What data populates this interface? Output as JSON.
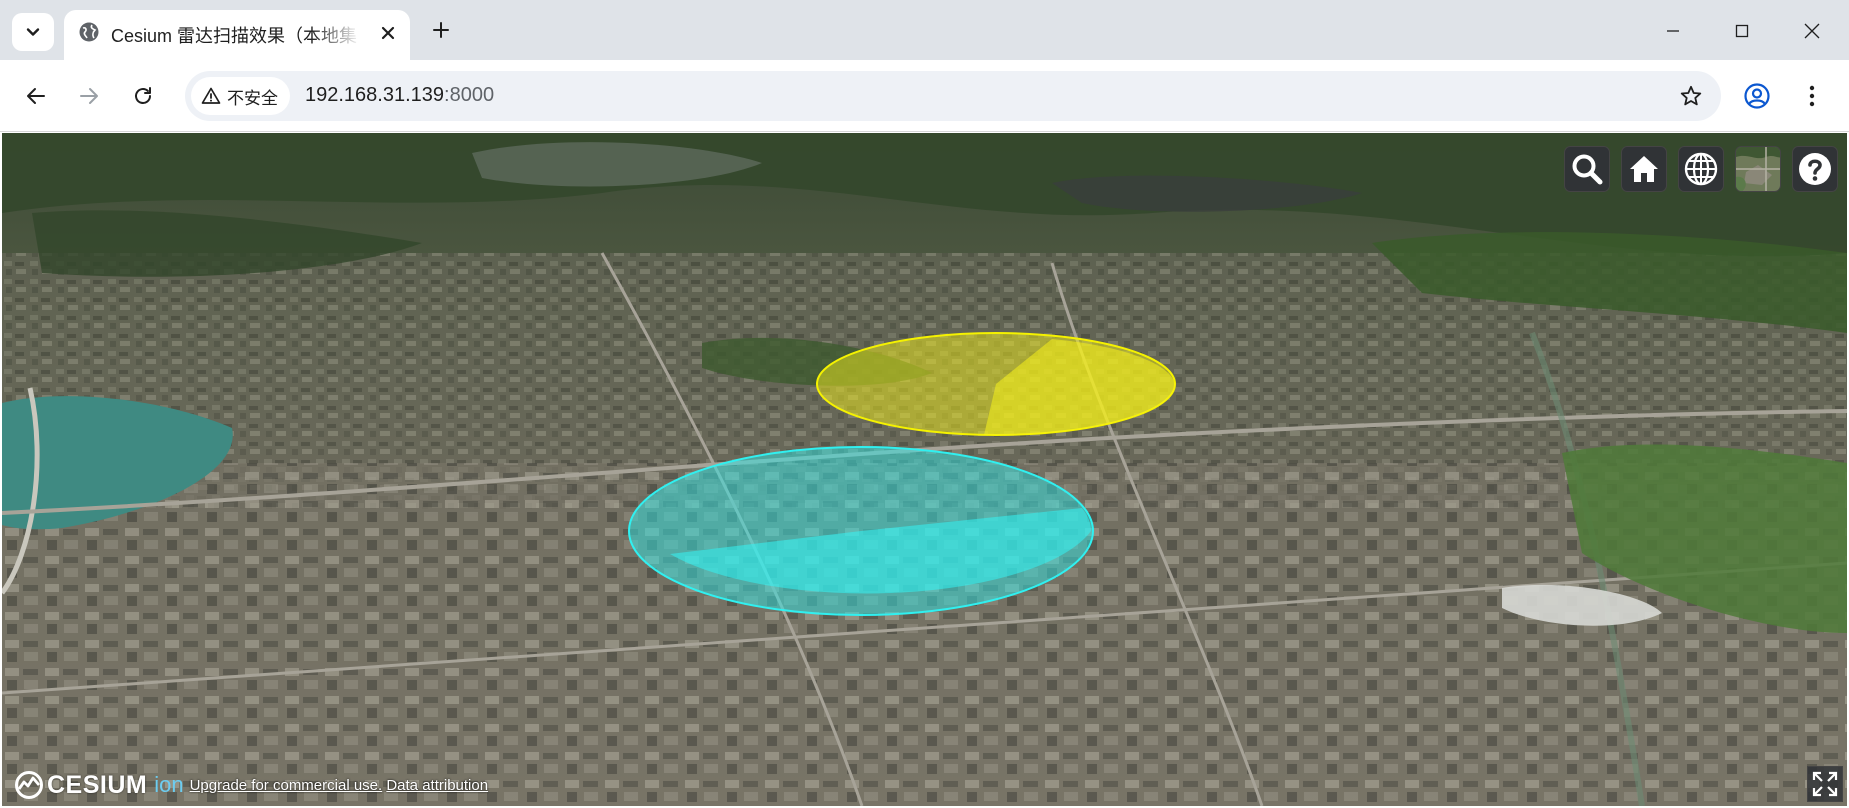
{
  "browser": {
    "tab": {
      "title": "Cesium 雷达扫描效果（本地集",
      "favicon": "globe-icon"
    },
    "new_tab_icon": "plus-icon",
    "tab_search_icon": "chevron-down-icon",
    "window_controls": [
      "minimize-icon",
      "maximize-icon",
      "close-icon"
    ],
    "nav": {
      "back": "arrow-left-icon",
      "forward": "arrow-right-icon",
      "reload": "reload-icon"
    },
    "security_label": "不安全",
    "url": {
      "host": "192.168.31.139",
      "port": ":8000"
    },
    "bookmark_icon": "star-icon",
    "profile_icon": "profile-icon",
    "menu_icon": "kebab-menu-icon"
  },
  "viewer": {
    "toolbar": [
      "search-icon",
      "home-icon",
      "globe-icon",
      "base-layer-picker",
      "help-icon"
    ],
    "radar_scans": [
      {
        "color": "#f2ee1a",
        "label": "yellow-radar-scan"
      },
      {
        "color": "#2fe6e6",
        "label": "cyan-radar-scan"
      }
    ],
    "credits": {
      "logo_text": "CESIUM",
      "logo_suffix": "ion",
      "upgrade_text": "Upgrade for commercial use.",
      "attribution_link": "Data attribution"
    },
    "fullscreen_icon": "fullscreen-icon"
  },
  "colors": {
    "chrome_bg": "#dfe3e8",
    "omnibox_bg": "#eef1f6",
    "cesium_button_bg": "#303336"
  }
}
